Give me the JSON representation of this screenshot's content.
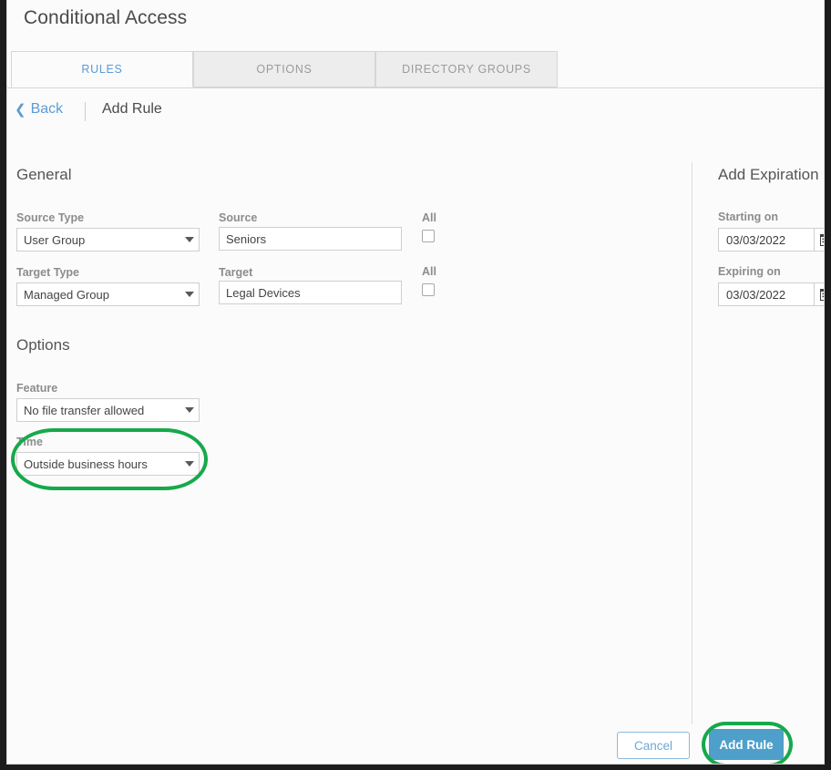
{
  "header": {
    "title": "Conditional Access"
  },
  "tabs": [
    {
      "label": "RULES",
      "active": true
    },
    {
      "label": "OPTIONS",
      "active": false
    },
    {
      "label": "DIRECTORY GROUPS",
      "active": false
    }
  ],
  "breadcrumb": {
    "back_label": "Back",
    "back_chevron": "chevron-left-icon",
    "current": "Add Rule"
  },
  "general": {
    "heading": "General",
    "source_type": {
      "label": "Source Type",
      "value": "User Group"
    },
    "source": {
      "label": "Source",
      "value": "Seniors",
      "placeholder": "Source"
    },
    "source_all": {
      "label": "All",
      "checked": false
    },
    "target_type": {
      "label": "Target Type",
      "value": "Managed Group"
    },
    "target": {
      "label": "Target",
      "value": "Legal Devices",
      "placeholder": "Target"
    },
    "target_all": {
      "label": "All",
      "checked": false
    }
  },
  "options": {
    "heading": "Options",
    "feature": {
      "label": "Feature",
      "value": "No file transfer allowed"
    },
    "time": {
      "label": "Time",
      "value": "Outside business hours"
    }
  },
  "expiration": {
    "heading": "Add Expiration",
    "starting_on": {
      "label": "Starting on",
      "value": "03/03/2022",
      "icon": "calendar-icon"
    },
    "expiring_on": {
      "label": "Expiring on",
      "value": "03/03/2022",
      "icon": "calendar-icon"
    }
  },
  "footer": {
    "cancel_label": "Cancel",
    "submit_label": "Add Rule"
  },
  "colors": {
    "accent_blue": "#5b9bd5",
    "primary_button": "#4e9fc9",
    "highlight_green": "#16a94b",
    "label_gray": "#8c8c8c",
    "page_background": "#fbfbfb"
  },
  "annotations": [
    {
      "name": "time-dropdown-highlight",
      "shape": "oval",
      "color": "#16a94b"
    },
    {
      "name": "add-rule-button-highlight",
      "shape": "oval",
      "color": "#16a94b"
    }
  ]
}
